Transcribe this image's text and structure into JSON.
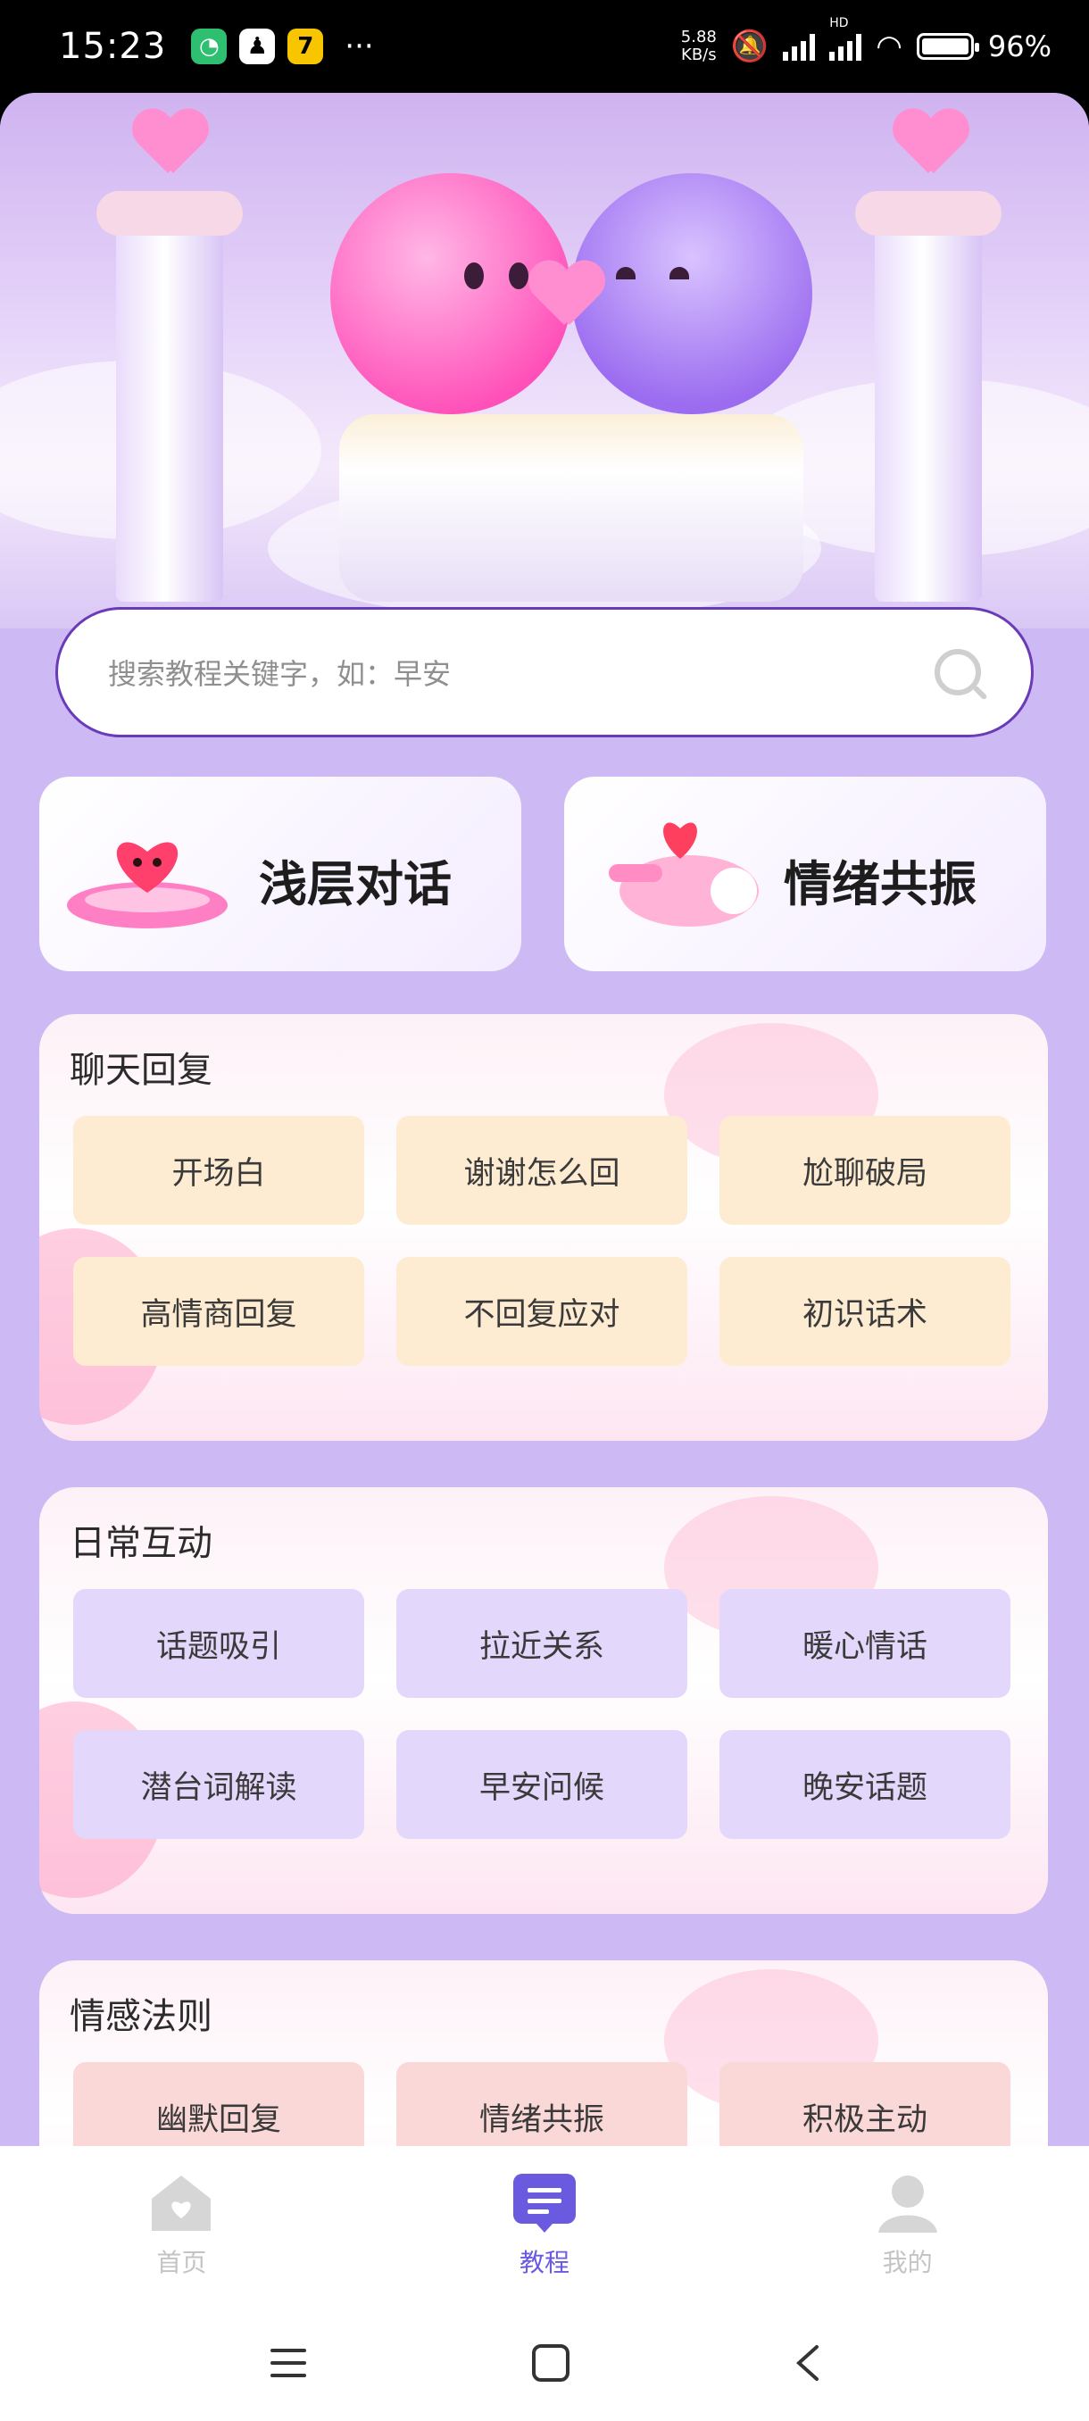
{
  "status_bar": {
    "time": "15:23",
    "netspeed_value": "5.88",
    "netspeed_unit": "KB/s",
    "battery": "96%",
    "network_label": "HD",
    "more": "···"
  },
  "search": {
    "placeholder": "搜索教程关键字，如：早安"
  },
  "features": [
    {
      "label": "浅层对话"
    },
    {
      "label": "情绪共振"
    }
  ],
  "sections": [
    {
      "title": "聊天回复",
      "items": [
        "开场白",
        "谢谢怎么回",
        "尬聊破局",
        "高情商回复",
        "不回复应对",
        "初识话术"
      ]
    },
    {
      "title": "日常互动",
      "items": [
        "话题吸引",
        "拉近关系",
        "暖心情话",
        "潜台词解读",
        "早安问候",
        "晚安话题"
      ]
    },
    {
      "title": "情感法则",
      "items": [
        "幽默回复",
        "情绪共振",
        "积极主动"
      ]
    }
  ],
  "bottom_nav": [
    {
      "label": "首页",
      "icon": "home-icon",
      "active": false
    },
    {
      "label": "教程",
      "icon": "tutorial-icon",
      "active": true
    },
    {
      "label": "我的",
      "icon": "profile-icon",
      "active": false
    }
  ],
  "colors": {
    "accent": "#6a5ae0",
    "background": "#cdb9f3",
    "chip_orange": "#fdebd2",
    "chip_purple": "#e3d7fb",
    "chip_red": "#fbd8d8"
  }
}
